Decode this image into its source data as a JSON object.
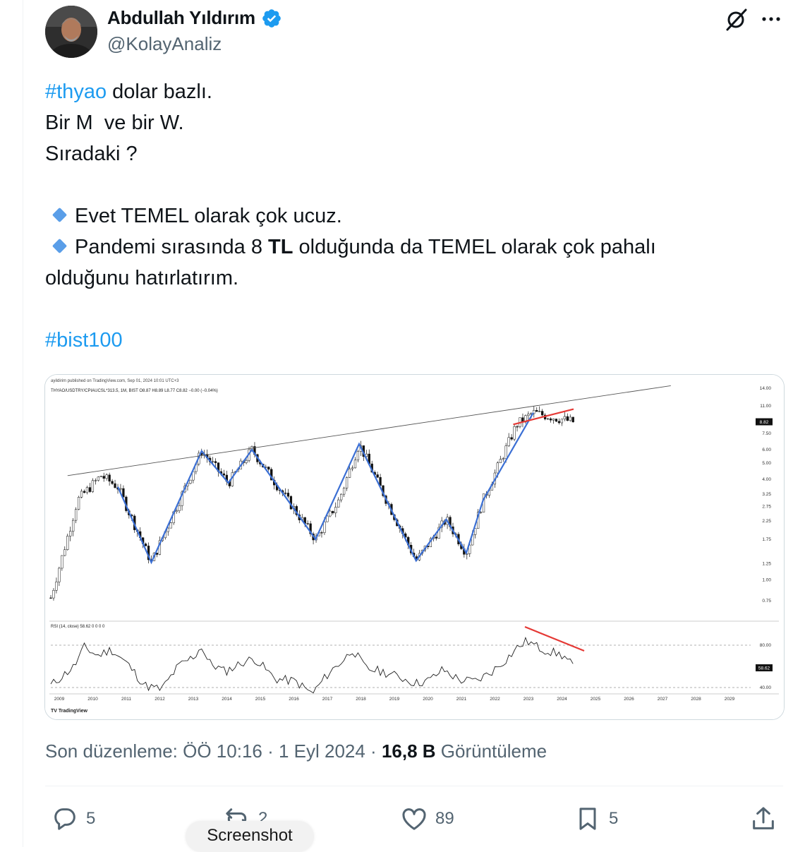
{
  "author": {
    "name": "Abdullah Yıldırım",
    "handle": "@KolayAnaliz",
    "verified": true,
    "verified_color": "#1d9bf0"
  },
  "header_icons": [
    "grok-icon",
    "more-icon"
  ],
  "tweet": {
    "lines": [
      {
        "hashtag": "#thyao",
        "text": " dolar bazlı."
      },
      {
        "text": "Bir M  ve bir W."
      },
      {
        "text": "Sıradaki ?"
      },
      {
        "bullet_text": "Evet TEMEL olarak çok ucuz."
      },
      {
        "bullet_pre": "Pandemi sırasında 8 ",
        "bullet_bold": "TL",
        "bullet_post": " olduğunda da TEMEL olarak çok pahalı"
      },
      {
        "text": "olduğunu hatırlatırım."
      },
      {
        "hashtag": "#bist100"
      }
    ],
    "hashtag_color": "#1d9bf0",
    "bullet_icon": "blue-diamond-icon"
  },
  "chart_data": {
    "type": "line",
    "header": "ayildirim published on TradingView.com, Sep 01, 2024 10:01 UTC+3",
    "symbol_line": "THYAO/USDTRY/CPIAUCSL*313.5, 1M, BIST  O8.87  H8.89  L8.77  C8.82  −0.00 (−0.04%)",
    "price_axis": [
      "14.00",
      "11.00",
      "7.50",
      "6.00",
      "5.00",
      "4.00",
      "3.25",
      "2.75",
      "2.25",
      "1.75",
      "1.25",
      "1.00",
      "0.75"
    ],
    "price_axis_scale": "log",
    "last_price": "8.82",
    "rsi_label": "RSI (14, close)  58.62  0  0  0  0",
    "rsi_axis": [
      "80.00",
      "40.00"
    ],
    "rsi_last": "58.62",
    "x_axis": [
      "2009",
      "2010",
      "2011",
      "2012",
      "2013",
      "2014",
      "2015",
      "2016",
      "2017",
      "2018",
      "2019",
      "2020",
      "2021",
      "2022",
      "2023",
      "2024",
      "2025",
      "2026",
      "2027",
      "2028",
      "2029"
    ],
    "series": [
      {
        "color": "#3b6fd4",
        "x": [
          2011.0,
          2012.0,
          2013.5,
          2014.3,
          2015.0,
          2016.9,
          2018.2,
          2019.9,
          2020.8,
          2021.4,
          2021.9,
          2023.4
        ],
        "y": [
          3.6,
          1.27,
          5.9,
          3.8,
          6.0,
          1.75,
          6.5,
          1.3,
          2.3,
          1.45,
          3.0,
          10.0
        ]
      },
      {
        "color": "#555555",
        "x": [
          2009.5,
          2027.5
        ],
        "y": [
          4.2,
          14.5
        ]
      },
      {
        "color": "#e53935",
        "x": [
          2022.8,
          2024.6
        ],
        "y": [
          8.5,
          10.5
        ]
      }
    ],
    "watermark": "TradingView",
    "rsi_divergence_color": "#e53935"
  },
  "footer": {
    "edited": "Son düzenleme: ÖÖ 10:16 · 1 Eyl 2024 · ",
    "views_count": "16,8 B",
    "views_label": " Görüntüleme"
  },
  "actions": {
    "replies": "5",
    "reposts": "2",
    "likes": "89",
    "bookmarks": "5"
  },
  "overlay_pill": "Screenshot"
}
